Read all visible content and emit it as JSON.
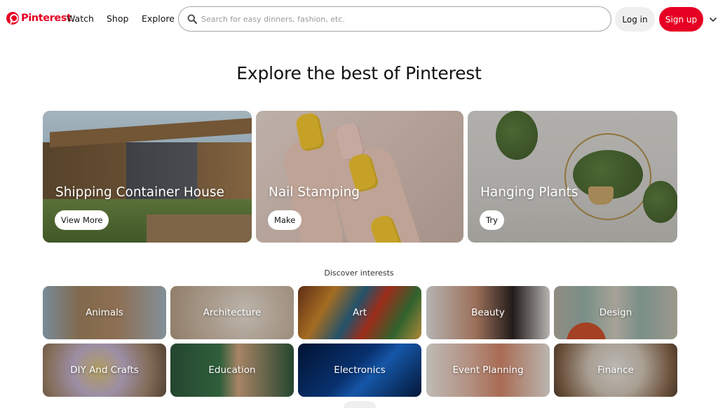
{
  "header": {
    "logo_text": "Pinterest",
    "nav": [
      {
        "label": "Watch"
      },
      {
        "label": "Shop"
      },
      {
        "label": "Explore"
      }
    ],
    "search": {
      "placeholder": "Search for easy dinners, fashion, etc.",
      "value": ""
    },
    "login_label": "Log in",
    "signup_label": "Sign up"
  },
  "colors": {
    "brand": "#e60023",
    "pill_bg": "#efefef"
  },
  "hero": {
    "title": "Explore the best of Pinterest",
    "cards": [
      {
        "title": "Shipping Container House",
        "button": "View More"
      },
      {
        "title": "Nail Stamping",
        "button": "Make"
      },
      {
        "title": "Hanging Plants",
        "button": "Try"
      }
    ]
  },
  "interests": {
    "heading": "Discover interests",
    "tiles": [
      {
        "label": "Animals"
      },
      {
        "label": "Architecture"
      },
      {
        "label": "Art"
      },
      {
        "label": "Beauty"
      },
      {
        "label": "Design"
      },
      {
        "label": "DIY And Crafts"
      },
      {
        "label": "Education"
      },
      {
        "label": "Electronics"
      },
      {
        "label": "Event Planning"
      },
      {
        "label": "Finance"
      }
    ]
  },
  "icons": {
    "logo": "pinterest-logo-icon",
    "search": "search-icon",
    "more": "chevron-down-icon"
  }
}
